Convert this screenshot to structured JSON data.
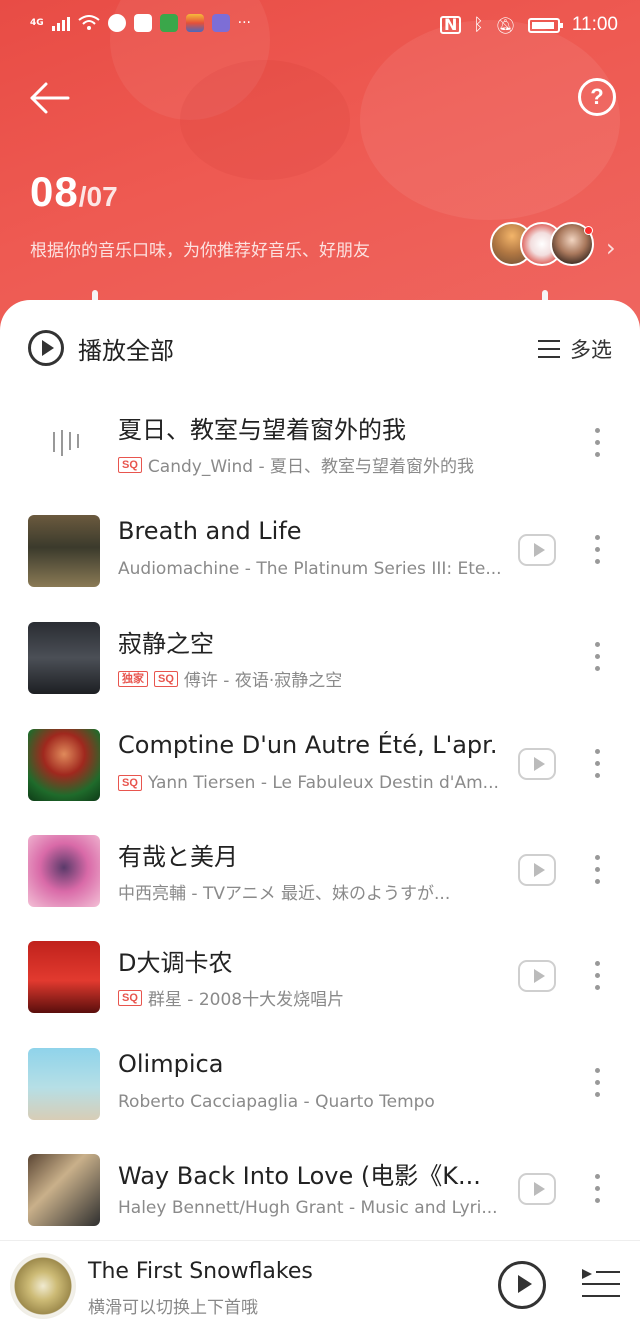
{
  "status_bar": {
    "network": "4G",
    "time": "11:00",
    "more": "···"
  },
  "header": {
    "date_day": "08",
    "date_month": "/07",
    "subtitle": "根据你的音乐口味，为你推荐好音乐、好朋友",
    "help_label": "?",
    "friends_chevron": "›"
  },
  "toolbar": {
    "play_all_label": "播放全部",
    "multi_select_label": "多选"
  },
  "songs": [
    {
      "title": "夏日、教室与望着窗外的我",
      "badges": [
        "SQ"
      ],
      "subtitle": "Candy_Wind - 夏日、教室与望着窗外的我",
      "has_mv": false
    },
    {
      "title": "Breath and Life",
      "badges": [],
      "subtitle": "Audiomachine - The Platinum Series III: Ete...",
      "has_mv": true
    },
    {
      "title": "寂静之空",
      "badges": [
        "独家",
        "SQ"
      ],
      "subtitle": "傅许 - 夜语·寂静之空",
      "has_mv": false
    },
    {
      "title": "Comptine D'un Autre Été, L'apr...",
      "badges": [
        "SQ"
      ],
      "subtitle": "Yann Tiersen - Le Fabuleux Destin d'Am...",
      "has_mv": true
    },
    {
      "title": "有哉と美月",
      "badges": [],
      "subtitle": "中西亮輔 - TVアニメ 最近、妹のようすが...",
      "has_mv": true
    },
    {
      "title": "D大调卡农",
      "badges": [
        "SQ"
      ],
      "subtitle": "群星 - 2008十大发烧唱片",
      "has_mv": true
    },
    {
      "title": "Olimpica",
      "badges": [],
      "subtitle": "Roberto Cacciapaglia - Quarto Tempo",
      "has_mv": false
    },
    {
      "title": "Way Back Into Love (电影《K...",
      "badges": [],
      "subtitle": "Haley Bennett/Hugh Grant - Music and Lyri...",
      "has_mv": true
    }
  ],
  "player": {
    "title": "The First Snowflakes",
    "subtitle": "横滑可以切换上下首哦"
  },
  "colors": {
    "header_red": "#e84c45",
    "badge_red": "#e8554e"
  }
}
